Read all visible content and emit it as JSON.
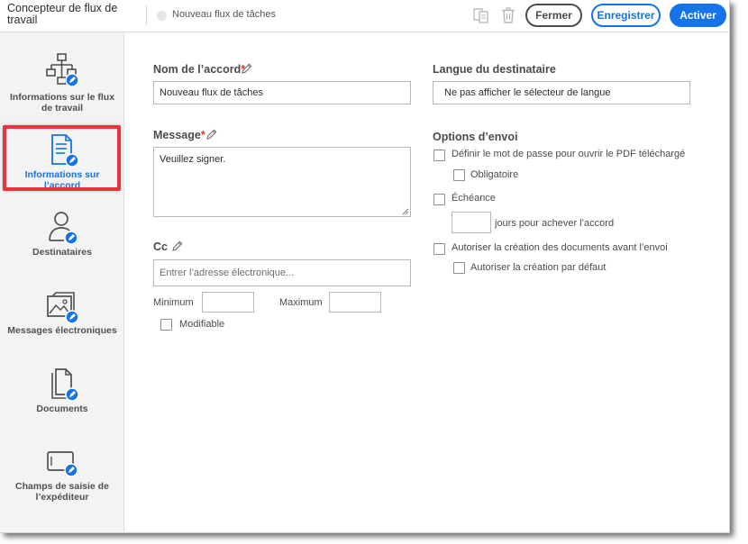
{
  "header": {
    "app_title": "Concepteur de flux de travail",
    "workflow_name": "Nouveau flux de tâches",
    "close_label": "Fermer",
    "save_label": "Enregistrer",
    "activate_label": "Activer"
  },
  "sidebar": {
    "items": [
      {
        "label": "Informations sur le flux de travail",
        "icon": "workflow-icon"
      },
      {
        "label": "Informations sur l’accord",
        "icon": "document-edit-icon"
      },
      {
        "label": "Destinataires",
        "icon": "user-icon"
      },
      {
        "label": "Messages électroniques",
        "icon": "email-image-icon"
      },
      {
        "label": "Documents",
        "icon": "documents-icon"
      },
      {
        "label": "Champs de saisie de l’expéditeur",
        "icon": "input-field-icon"
      }
    ]
  },
  "form": {
    "agreement_name_label": "Nom de l’accord",
    "agreement_name_value": "Nouveau flux de tâches",
    "message_label": "Message",
    "message_value": "Veuillez signer.",
    "cc_label": "Cc",
    "cc_placeholder": "Entrer l’adresse électronique...",
    "minimum_label": "Minimum",
    "maximum_label": "Maximum",
    "editable_label": "Modifiable",
    "recipient_language_label": "Langue du destinataire",
    "recipient_language_value": "Ne pas afficher le sélecteur de langue",
    "send_options_label": "Options d’envoi",
    "password_option": "Définir le mot de passe pour ouvrir le PDF téléchargé",
    "required_option": "Obligatoire",
    "deadline_option": "Échéance",
    "days_text": "jours pour achever l’accord",
    "allow_docs_option": "Autoriser la création des documents avant l’envoi",
    "allow_default_option": "Autoriser la création par défaut",
    "required_marker": "*"
  },
  "colors": {
    "accent": "#1473e6",
    "highlight": "#e8343f",
    "required": "#d7373f"
  }
}
